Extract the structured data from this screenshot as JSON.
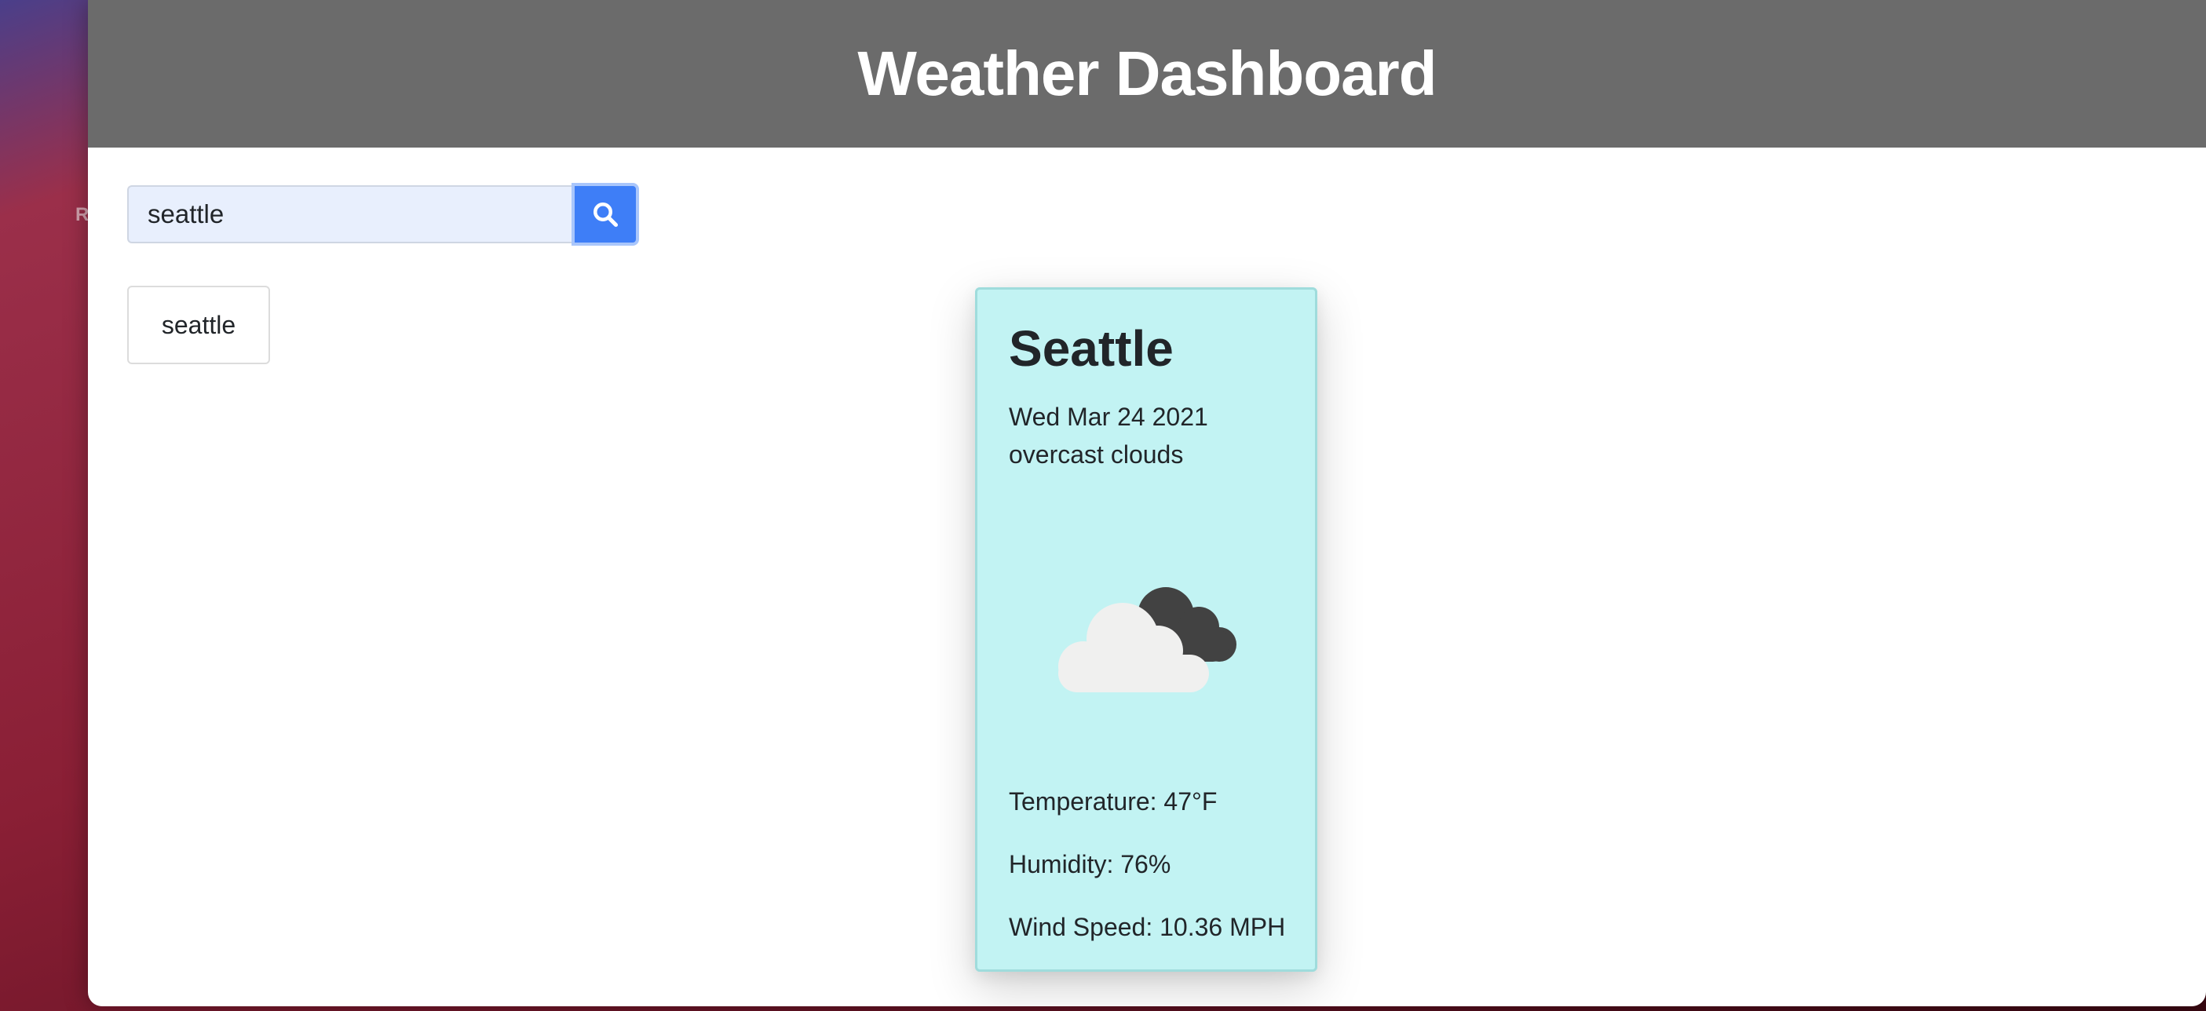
{
  "app": {
    "title": "Weather Dashboard"
  },
  "search": {
    "value": "seattle"
  },
  "history": [
    {
      "label": "seattle"
    }
  ],
  "current": {
    "city": "Seattle",
    "date": "Wed Mar 24 2021",
    "description": "overcast clouds",
    "icon": "overcast-clouds-icon",
    "temperature": "Temperature: 47°F",
    "humidity": "Humidity: 76%",
    "wind": "Wind Speed: 10.36 MPH"
  },
  "desktop": {
    "peek_text": "R"
  },
  "colors": {
    "header_bg": "#6b6b6b",
    "accent": "#3e7ef7",
    "card_bg": "#c2f3f3"
  }
}
